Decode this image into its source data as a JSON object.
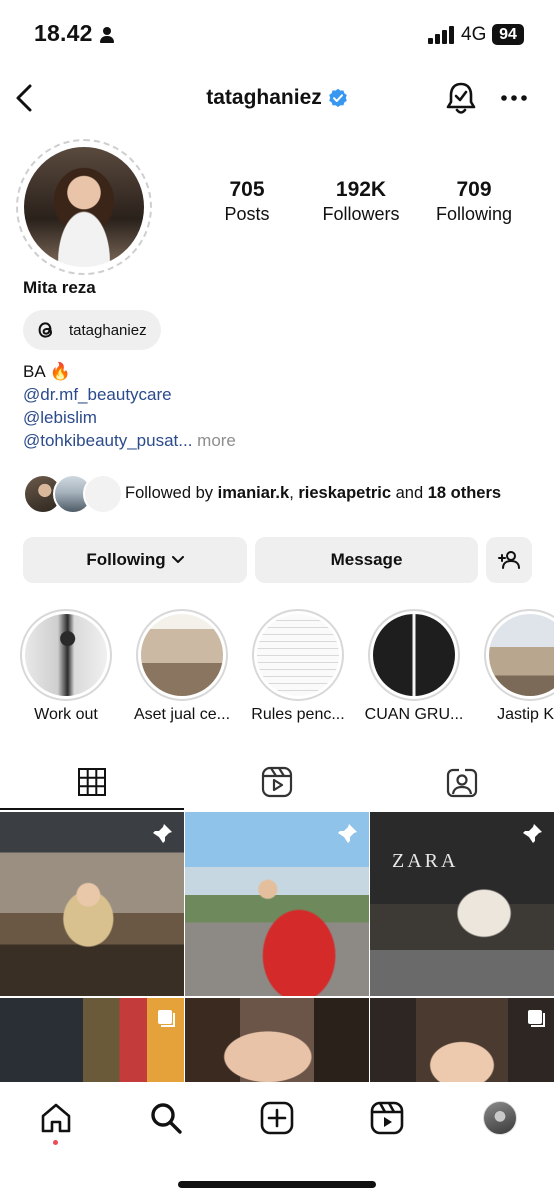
{
  "status_bar": {
    "time": "18.42",
    "network": "4G",
    "battery": "94"
  },
  "header": {
    "username": "tataghaniez"
  },
  "profile": {
    "stats": [
      {
        "value": "705",
        "label": "Posts"
      },
      {
        "value": "192K",
        "label": "Followers"
      },
      {
        "value": "709",
        "label": "Following"
      }
    ],
    "display_name": "Mita reza",
    "threads_handle": "tataghaniez",
    "bio": {
      "line1": "BA 🔥",
      "link1": "@dr.mf_beautycare",
      "link2": "@lebislim",
      "link3": "@tohkibeauty_pusat...",
      "more": "more"
    },
    "followed_by": {
      "prefix": "Followed by ",
      "user1": "imaniar.k",
      "separator": ", ",
      "user2": "rieskapetric",
      "mid": " and ",
      "others": "18 others"
    }
  },
  "actions": {
    "following": "Following",
    "message": "Message"
  },
  "highlights": [
    {
      "label": "Work out"
    },
    {
      "label": "Aset jual ce..."
    },
    {
      "label": "Rules penc..."
    },
    {
      "label": "CUAN GRU..."
    },
    {
      "label": "Jastip KL"
    }
  ],
  "grid_text": {
    "zara_sign": "ZARA"
  },
  "colors": {
    "link": "#2b4b8c",
    "verified": "#3897f0",
    "notification_dot": "#ed4956",
    "button_bg": "#efefef"
  }
}
